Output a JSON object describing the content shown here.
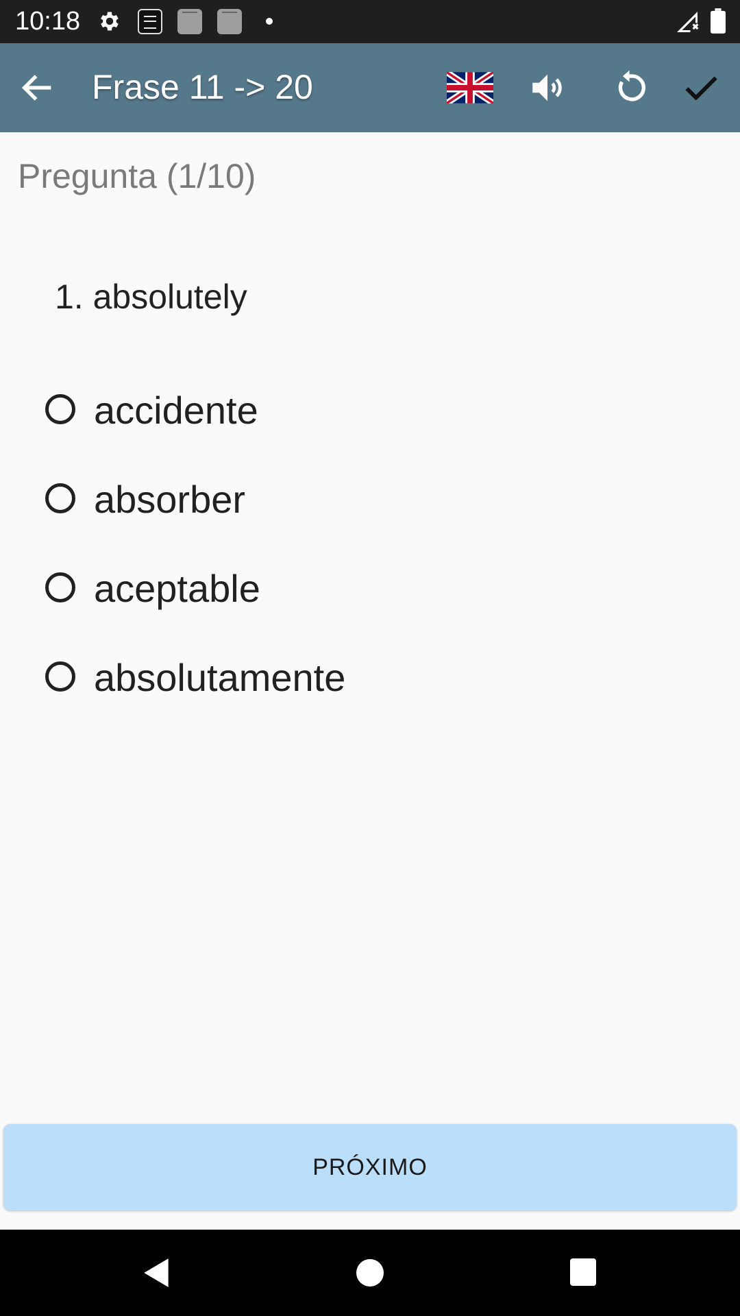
{
  "status_bar": {
    "time": "10:18",
    "icons": [
      "gear-icon",
      "app-thumbnail-icon",
      "app-thumbnail-icon",
      "app-thumbnail-icon",
      "notification-dot-icon",
      "signal-icon",
      "battery-icon"
    ]
  },
  "app_bar": {
    "title": "Frase 11 -> 20",
    "icons": [
      "back-arrow-icon",
      "uk-flag-icon",
      "speaker-icon",
      "reset-icon",
      "checkmark-icon"
    ]
  },
  "quiz": {
    "counter": "Pregunta (1/10)",
    "question": "1. absolutely",
    "options": [
      {
        "label": "accidente",
        "selected": false
      },
      {
        "label": "absorber",
        "selected": false
      },
      {
        "label": "aceptable",
        "selected": false
      },
      {
        "label": "absolutamente",
        "selected": false
      }
    ]
  },
  "next_button": {
    "label": "PRÓXIMO",
    "color": "#bbdefa"
  },
  "colors": {
    "app_bar": "#56788b",
    "status_bar": "#1f1f1f",
    "background": "#fafafa"
  },
  "nav_bar": {
    "icons": [
      "back-triangle-icon",
      "home-circle-icon",
      "recents-square-icon"
    ]
  }
}
